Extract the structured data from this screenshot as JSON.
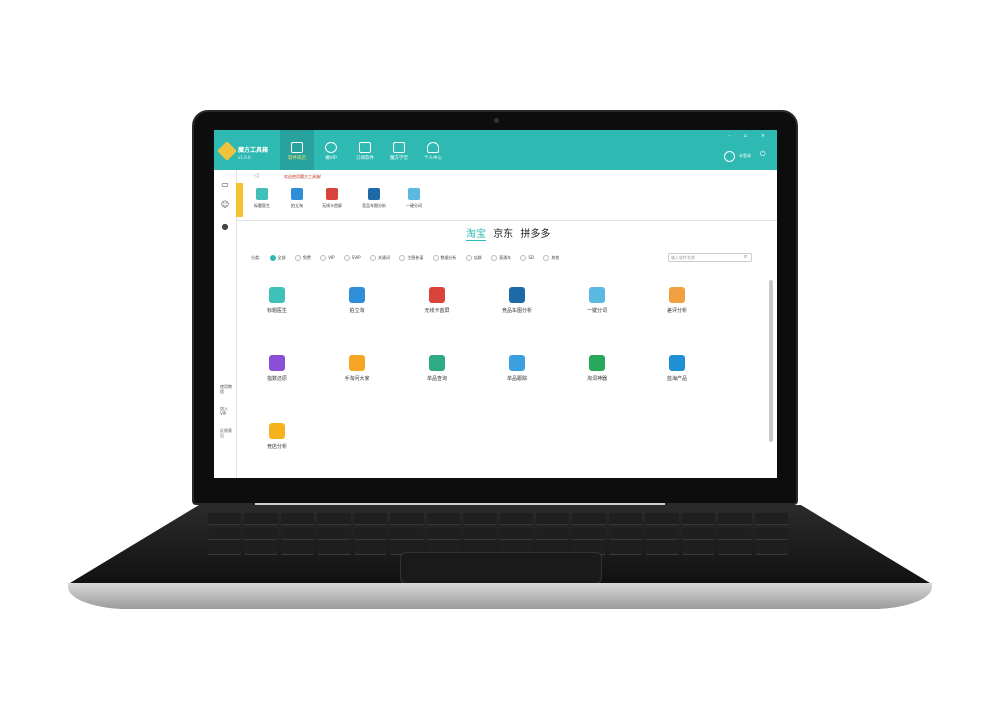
{
  "app": {
    "name": "魔方工具箱",
    "version": "v1.0.0"
  },
  "nav": [
    {
      "label": "软件商店",
      "icon": "grid-icon",
      "active": true
    },
    {
      "label": "做VIP",
      "icon": "diamond-icon",
      "active": false
    },
    {
      "label": "订阅软件",
      "icon": "subscribe-icon",
      "active": false
    },
    {
      "label": "魔方学堂",
      "icon": "school-icon",
      "active": false
    },
    {
      "label": "个人中心",
      "icon": "user-icon",
      "active": false
    }
  ],
  "account": {
    "login_label": "未登录"
  },
  "window_controls": "- ▫ ×",
  "sidebar": {
    "links": [
      "使用教程",
      "加入VIP",
      "反馈意见"
    ]
  },
  "notice": "欢迎使用魔方工具箱!",
  "quick_access": [
    {
      "label": "标题医生",
      "color": "#3fc1b9"
    },
    {
      "label": "拍立淘",
      "color": "#2e8fd8"
    },
    {
      "label": "无线卡首屏",
      "color": "#d9433b"
    },
    {
      "label": "竞品车图分析",
      "color": "#1e6aa8"
    },
    {
      "label": "一键分词",
      "color": "#5bb8e0"
    }
  ],
  "platforms": [
    "淘宝",
    "京东",
    "拼多多"
  ],
  "filter": {
    "label": "分类:",
    "options": [
      "全部",
      "免费",
      "VIP",
      "SVIP",
      "关键词",
      "主图参谋",
      "数据分析",
      "店群",
      "直通车",
      "SD",
      "其他"
    ],
    "selected": "全部"
  },
  "search": {
    "placeholder": "输入软件名称"
  },
  "tools": [
    {
      "label": "标题医生",
      "color": "#3fc1b9"
    },
    {
      "label": "拍立淘",
      "color": "#2e8fd8"
    },
    {
      "label": "无线卡首屏",
      "color": "#d9433b"
    },
    {
      "label": "竞品车图分析",
      "color": "#1e6aa8"
    },
    {
      "label": "一键分词",
      "color": "#5bb8e0"
    },
    {
      "label": "差评分析",
      "color": "#f0a040"
    },
    {
      "label": "指数还原",
      "color": "#8a4fd6"
    },
    {
      "label": "手淘问大家",
      "color": "#f5a623"
    },
    {
      "label": "单品查询",
      "color": "#2eaa84"
    },
    {
      "label": "单品跟踪",
      "color": "#3aa0e0"
    },
    {
      "label": "淘词神器",
      "color": "#27a85a"
    },
    {
      "label": "蓝海产品",
      "color": "#1f8fd6"
    },
    {
      "label": "竞店分析",
      "color": "#f5b21d"
    }
  ]
}
